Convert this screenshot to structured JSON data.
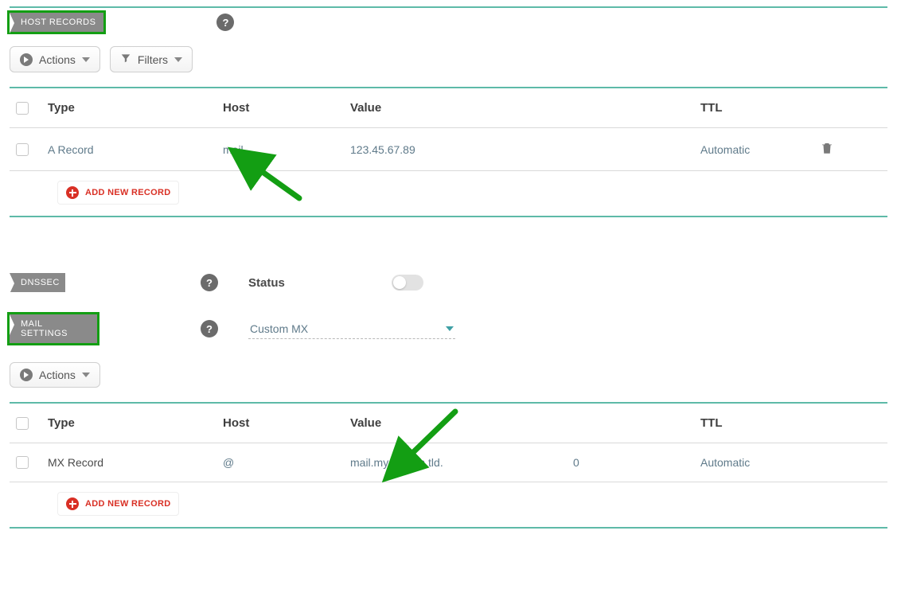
{
  "colors": {
    "highlight": "#139e13",
    "teal": "#5ebaa8",
    "link": "#5f7a8a",
    "danger": "#d93025"
  },
  "host_records": {
    "tab_label": "HOST RECORDS",
    "actions_label": "Actions",
    "filters_label": "Filters",
    "columns": {
      "type": "Type",
      "host": "Host",
      "value": "Value",
      "ttl": "TTL"
    },
    "rows": [
      {
        "type": "A Record",
        "host": "mail",
        "value": "123.45.67.89",
        "ttl": "Automatic"
      }
    ],
    "add_label": "ADD NEW RECORD"
  },
  "dnssec": {
    "tab_label": "DNSSEC",
    "status_label": "Status",
    "status_on": false
  },
  "mail_settings": {
    "tab_label": "MAIL SETTINGS",
    "selected_option": "Custom MX",
    "actions_label": "Actions",
    "columns": {
      "type": "Type",
      "host": "Host",
      "value": "Value",
      "priority": "",
      "ttl": "TTL"
    },
    "rows": [
      {
        "type": "MX Record",
        "host": "@",
        "value": "mail.mydomain.tld.",
        "priority": "0",
        "ttl": "Automatic"
      }
    ],
    "add_label": "ADD NEW RECORD"
  }
}
